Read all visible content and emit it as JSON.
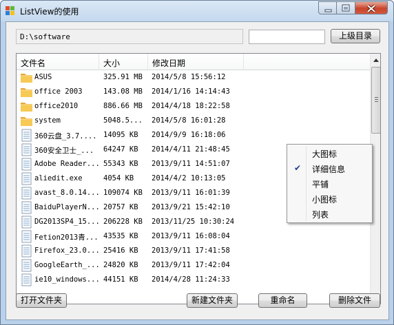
{
  "window": {
    "title": "ListView的使用",
    "accent_close": "#c8442b"
  },
  "toolbar": {
    "path_value": "D:\\software",
    "filter_value": "",
    "up_button_label": "上级目录"
  },
  "listview": {
    "columns": [
      "文件名",
      "大小",
      "修改日期"
    ],
    "rows": [
      {
        "icon": "folder-icon",
        "name": "ASUS",
        "size": "325.91 MB",
        "date": "2014/5/8 15:56:12"
      },
      {
        "icon": "folder-icon",
        "name": "office 2003",
        "size": "143.08 MB",
        "date": "2014/1/16 14:14:43"
      },
      {
        "icon": "folder-icon",
        "name": "office2010",
        "size": "886.66 MB",
        "date": "2014/4/18 18:22:58"
      },
      {
        "icon": "folder-icon",
        "name": "system",
        "size": "5048.5...",
        "date": "2014/5/8 16:01:28"
      },
      {
        "icon": "file-icon",
        "name": "360云盘_3.7....",
        "size": "14095 KB",
        "date": "2014/9/9 16:18:06"
      },
      {
        "icon": "file-icon",
        "name": "360安全卫士_...",
        "size": "64247 KB",
        "date": "2014/4/11 21:48:45"
      },
      {
        "icon": "file-icon",
        "name": "Adobe Reader...",
        "size": "55343 KB",
        "date": "2013/9/11 14:51:07"
      },
      {
        "icon": "file-icon",
        "name": "aliedit.exe",
        "size": "4054 KB",
        "date": "2014/4/2 10:13:05"
      },
      {
        "icon": "file-icon",
        "name": "avast_8.0.14...",
        "size": "109074 KB",
        "date": "2013/9/11 16:01:39"
      },
      {
        "icon": "file-icon",
        "name": "BaiduPlayerN...",
        "size": "20757 KB",
        "date": "2013/9/21 15:42:10"
      },
      {
        "icon": "file-icon",
        "name": "DG2013SP4_15...",
        "size": "206228 KB",
        "date": "2013/11/25 10:30:24"
      },
      {
        "icon": "file-icon",
        "name": "Fetion2013青...",
        "size": "43535 KB",
        "date": "2013/9/11 16:08:04"
      },
      {
        "icon": "file-icon",
        "name": "Firefox_23.0...",
        "size": "25416 KB",
        "date": "2013/9/11 17:41:58"
      },
      {
        "icon": "file-icon",
        "name": "GoogleEarth_...",
        "size": "24820 KB",
        "date": "2013/9/11 17:42:04"
      },
      {
        "icon": "file-icon",
        "name": "ie10_windows...",
        "size": "44151 KB",
        "date": "2014/4/28 11:24:33"
      }
    ]
  },
  "context_menu": {
    "items": [
      {
        "label": "大图标",
        "checked": false
      },
      {
        "label": "详细信息",
        "checked": true
      },
      {
        "label": "平铺",
        "checked": false
      },
      {
        "label": "小图标",
        "checked": false
      },
      {
        "label": "列表",
        "checked": false
      }
    ],
    "check_glyph": "✔"
  },
  "bottom_buttons": {
    "open_folder": "打开文件夹",
    "new_folder": "新建文件夹",
    "rename": "重命名",
    "delete_file": "删除文件"
  }
}
